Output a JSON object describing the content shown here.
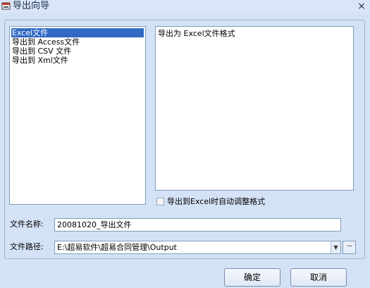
{
  "window": {
    "title": "导出向导",
    "close_glyph": "×"
  },
  "formats": {
    "items": [
      {
        "label": "Excel文件",
        "selected": true
      },
      {
        "label": "导出到 Access文件",
        "selected": false
      },
      {
        "label": "导出到 CSV 文件",
        "selected": false
      },
      {
        "label": "导出到 Xml文件",
        "selected": false
      }
    ]
  },
  "description": {
    "text": "导出为 Excel文件格式"
  },
  "options": {
    "auto_adjust_label": "导出到Excel时自动调整格式",
    "auto_adjust_checked": false
  },
  "file_name": {
    "label": "文件名称:",
    "value": "20081020_导出文件"
  },
  "file_path": {
    "label": "文件路径:",
    "value": "E:\\超易软件\\超易合同管理\\Output",
    "browse_label": "···"
  },
  "buttons": {
    "ok": "确定",
    "cancel": "取消"
  }
}
